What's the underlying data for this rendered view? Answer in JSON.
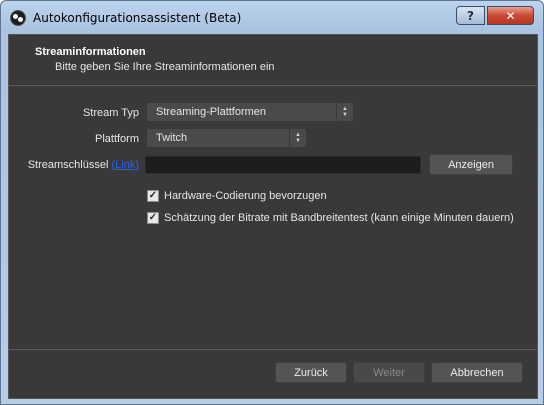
{
  "window": {
    "title": "Autokonfigurationsassistent (Beta)",
    "help_label": "?",
    "close_label": "✕"
  },
  "header": {
    "title": "Streaminformationen",
    "subtitle": "Bitte geben Sie Ihre Streaminformationen ein"
  },
  "form": {
    "stream_type_label": "Stream Typ",
    "stream_type_value": "Streaming-Plattformen",
    "platform_label": "Plattform",
    "platform_value": "Twitch",
    "stream_key_label": "Streamschlüssel",
    "stream_key_link": "(Link)",
    "stream_key_value": "",
    "show_button": "Anzeigen",
    "hw_encoding_label": "Hardware-Codierung bevorzugen",
    "hw_encoding_checked": true,
    "bitrate_test_label": "Schätzung der Bitrate mit Bandbreitentest (kann einige Minuten dauern)",
    "bitrate_test_checked": true
  },
  "footer": {
    "back_label": "Zurück",
    "next_label": "Weiter",
    "cancel_label": "Abbrechen"
  },
  "colors": {
    "background": "#3a393a",
    "link": "#2563eb"
  }
}
